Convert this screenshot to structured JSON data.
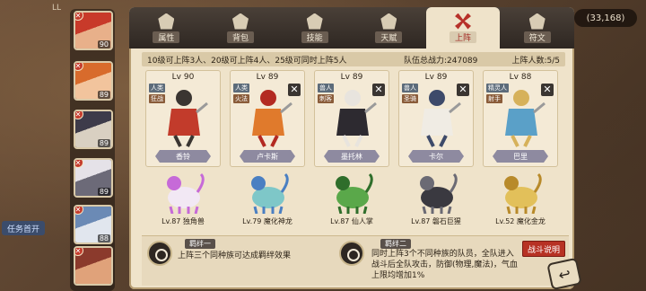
{
  "world": {
    "top_text": "LL",
    "top_pill": "(33,168)",
    "left_tag": "任务首开"
  },
  "hero_rail": [
    {
      "level": "90",
      "colors": [
        "#c83a2a",
        "#e8b08a"
      ]
    },
    {
      "level": "89",
      "colors": [
        "#d86b2c",
        "#f2c49d"
      ]
    },
    {
      "level": "89",
      "colors": [
        "#3d3b4a",
        "#d9d0c2"
      ]
    },
    {
      "level": "89",
      "colors": [
        "#e5e2e8",
        "#6c6a78"
      ]
    },
    {
      "level": "88",
      "colors": [
        "#6b8ab5",
        "#e1e6ee"
      ]
    },
    {
      "level": "",
      "colors": [
        "#8b3a2c",
        "#e0a27a"
      ]
    }
  ],
  "tabs": [
    {
      "label": "属性"
    },
    {
      "label": "背包"
    },
    {
      "label": "技能"
    },
    {
      "label": "天赋"
    },
    {
      "label": "上阵"
    },
    {
      "label": "符文"
    }
  ],
  "active_tab": 4,
  "lineup": {
    "rule": "10级可上阵3人、20级可上阵4人、25级可同时上阵5人",
    "power": "队伍总战力:247089",
    "count": "上阵人数:5/5"
  },
  "cards": [
    {
      "level": "Lv 90",
      "tag1": "人类",
      "tag2": "狂战",
      "name": "香铃",
      "removable": false,
      "colors": [
        "#c23b2b",
        "#3a3531"
      ]
    },
    {
      "level": "Lv 89",
      "tag1": "人类",
      "tag2": "火法",
      "name": "卢卡斯",
      "removable": true,
      "colors": [
        "#e07a2c",
        "#b32a22"
      ]
    },
    {
      "level": "Lv 89",
      "tag1": "兽人",
      "tag2": "刺客",
      "name": "墨托林",
      "removable": true,
      "colors": [
        "#2d2a30",
        "#e8e4de"
      ]
    },
    {
      "level": "Lv 89",
      "tag1": "兽人",
      "tag2": "圣骑",
      "name": "卡尔",
      "removable": true,
      "colors": [
        "#f0ece4",
        "#3d4a6a"
      ]
    },
    {
      "level": "Lv 88",
      "tag1": "精灵人",
      "tag2": "射手",
      "name": "巴里",
      "removable": true,
      "colors": [
        "#5aa0c8",
        "#d6b15a"
      ]
    }
  ],
  "pets": [
    {
      "label": "Lv.87 独角兽",
      "colors": [
        "#f2e8f4",
        "#c66ad8"
      ]
    },
    {
      "label": "Lv.79 魔化神龙",
      "colors": [
        "#7ec7c8",
        "#4a7fc2"
      ]
    },
    {
      "label": "Lv.87 仙人掌",
      "colors": [
        "#5aa84a",
        "#2f6e2b"
      ]
    },
    {
      "label": "Lv.87 磐石巨猩",
      "colors": [
        "#3a3940",
        "#6b6a74"
      ]
    },
    {
      "label": "Lv.52 魔化金龙",
      "colors": [
        "#e2c05a",
        "#b88a2a"
      ]
    }
  ],
  "bond1": {
    "title": "羁绊一",
    "desc": "上阵三个同种族可达成羁绊效果"
  },
  "bond2": {
    "title": "羁绊二",
    "desc_line1": "同时上阵3个不同种族的队员，全队进入",
    "desc_line2": "战斗后全队攻击，防御(物理,魔法)，气血",
    "desc_line3": "上限均增加1%"
  },
  "buttons": {
    "battle_info": "战斗说明",
    "back_icon": "↩"
  },
  "hero_rail_badge": "✕"
}
